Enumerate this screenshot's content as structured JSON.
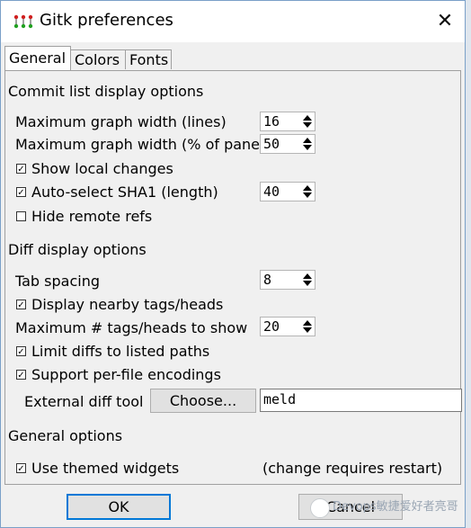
{
  "window": {
    "title": "Gitk preferences",
    "close_glyph": "✕"
  },
  "tabs": [
    {
      "label": "General",
      "active": true
    },
    {
      "label": "Colors",
      "active": false
    },
    {
      "label": "Fonts",
      "active": false
    }
  ],
  "commit_list": {
    "heading": "Commit list display options",
    "max_graph_width_lines": {
      "label": "Maximum graph width (lines)",
      "value": "16"
    },
    "max_graph_width_pct": {
      "label": "Maximum graph width (% of pane)",
      "value": "50"
    },
    "show_local_changes": {
      "label": "Show local changes",
      "checked": true
    },
    "auto_select_sha1": {
      "label": "Auto-select SHA1 (length)",
      "checked": true,
      "value": "40"
    },
    "hide_remote_refs": {
      "label": "Hide remote refs",
      "checked": false
    }
  },
  "diff": {
    "heading": "Diff display options",
    "tab_spacing": {
      "label": "Tab spacing",
      "value": "8"
    },
    "display_nearby_tags": {
      "label": "Display nearby tags/heads",
      "checked": true
    },
    "max_tags_heads": {
      "label": "Maximum # tags/heads to show",
      "value": "20"
    },
    "limit_diffs": {
      "label": "Limit diffs to listed paths",
      "checked": true
    },
    "per_file_encodings": {
      "label": "Support per-file encodings",
      "checked": true
    },
    "external_diff": {
      "label": "External diff tool",
      "button": "Choose...",
      "value": "meld"
    }
  },
  "general": {
    "heading": "General options",
    "use_themed_widgets": {
      "label": "Use themed widgets",
      "checked": true,
      "note": "(change requires restart)"
    }
  },
  "buttons": {
    "ok": "OK",
    "cancel": "Cancel"
  },
  "watermark": "Devops敏捷爱好者亮哥",
  "check_glyph": "✓"
}
